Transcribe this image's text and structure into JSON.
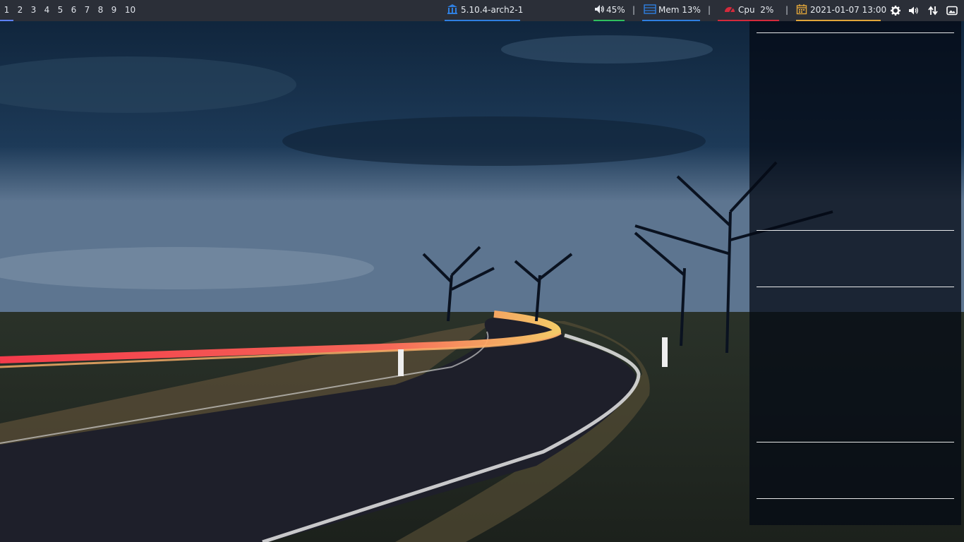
{
  "workspaces": [
    "1",
    "2",
    "3",
    "4",
    "5",
    "6",
    "7",
    "8",
    "9",
    "10"
  ],
  "active_workspace": "1",
  "kernel": {
    "icon": "bank-icon",
    "label": "5.10.4-arch2-1",
    "color": "#2f7fe0"
  },
  "volume": {
    "icon": "speaker-icon",
    "label": "45%",
    "color": "#2fbf5f"
  },
  "memory": {
    "icon": "memory-icon",
    "label": "Mem 13%",
    "color": "#2f7fe0"
  },
  "cpu": {
    "icon": "gauge-icon",
    "label": "Cpu",
    "value": "2%",
    "color": "#d42a3c"
  },
  "date": {
    "icon": "calendar-icon",
    "label": "2021-01-07 13:00",
    "color": "#e0a53a"
  },
  "separator": "|",
  "tray": [
    "gear-icon",
    "volume-tray-icon",
    "network-arrows-icon",
    "image-icon"
  ],
  "colors": {
    "bar_bg": "#2b2f38",
    "workspace_active": "#5e81ff",
    "panel_bg": "rgba(4,10,20,0.74)"
  }
}
